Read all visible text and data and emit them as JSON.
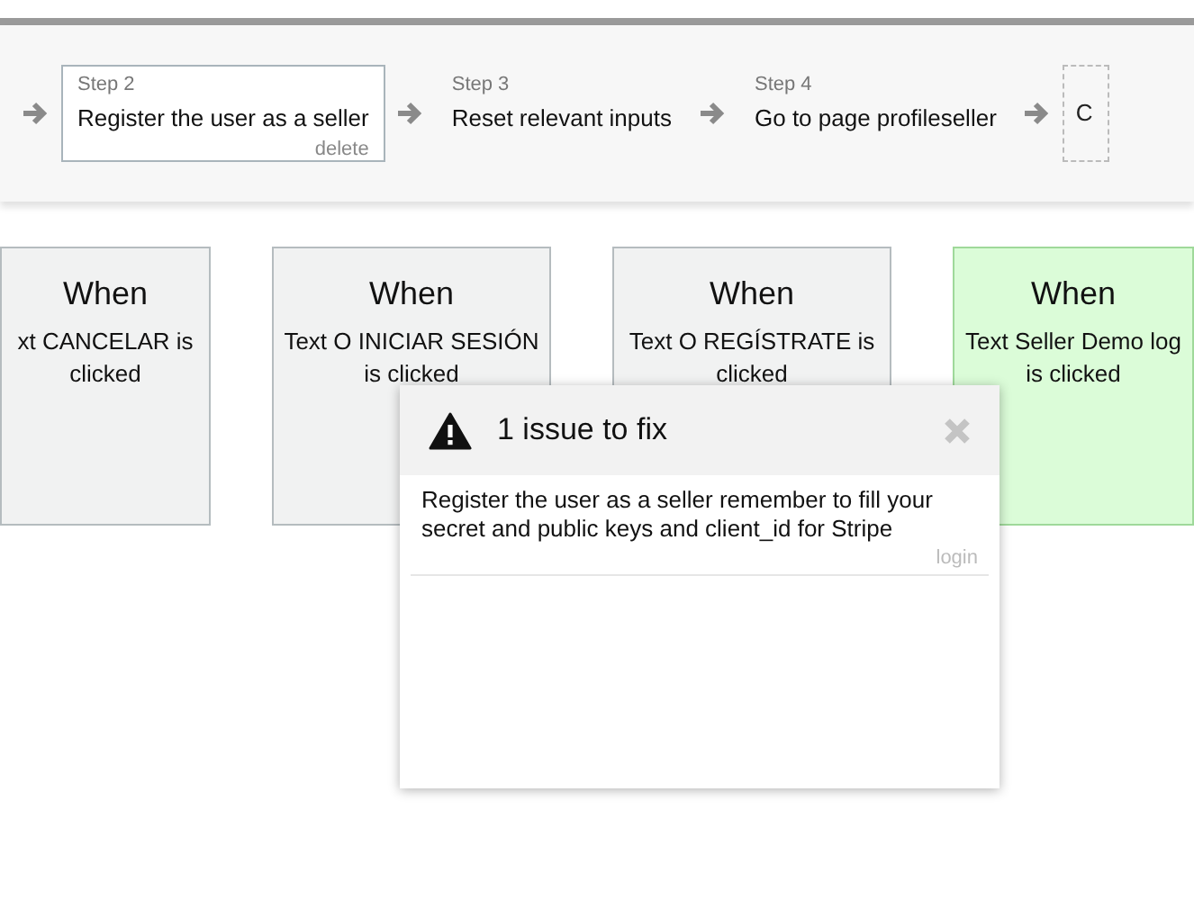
{
  "steps": [
    {
      "kind": "step",
      "label": "Step 2",
      "title": "Register the user as a seller",
      "action": "delete",
      "selected": true
    },
    {
      "kind": "step",
      "label": "Step 3",
      "title": "Reset relevant inputs",
      "selected": false
    },
    {
      "kind": "step",
      "label": "Step 4",
      "title": "Go to page profileseller",
      "selected": false
    },
    {
      "kind": "placeholder",
      "title": "C"
    }
  ],
  "events": [
    {
      "heading": "When",
      "text": "xt CANCELAR is clicked",
      "highlighted": false
    },
    {
      "heading": "When",
      "text": "Text O INICIAR SESIÓN is clicked",
      "highlighted": false
    },
    {
      "heading": "When",
      "text": "Text O REGÍSTRATE is clicked",
      "highlighted": false
    },
    {
      "heading": "When",
      "text": "Text Seller Demo log is clicked",
      "highlighted": true
    }
  ],
  "issues_dialog": {
    "title": "1 issue to fix",
    "issues": [
      {
        "message": "Register the user as a seller remember to fill your secret and public keys and client_id for Stripe",
        "source": "login"
      }
    ]
  }
}
